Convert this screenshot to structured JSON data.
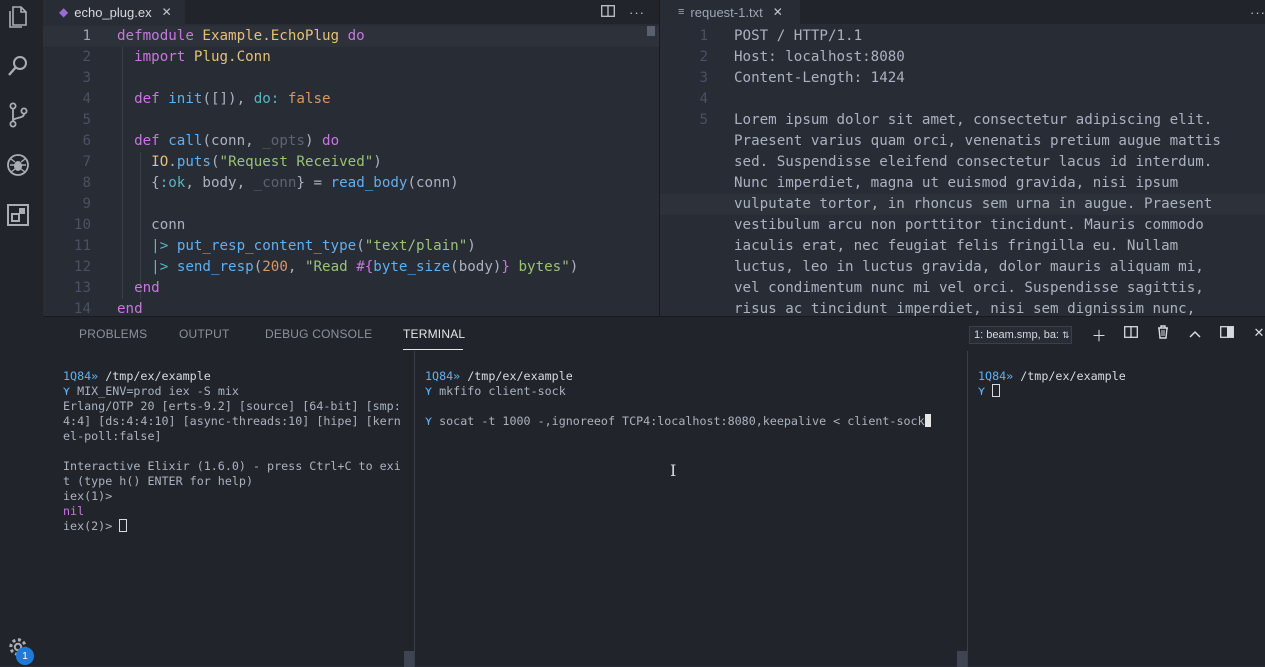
{
  "activity": {
    "icons": [
      "files-icon",
      "search-icon",
      "source-control-icon",
      "debug-icon",
      "extensions-icon",
      "gear-icon"
    ],
    "badge": "1"
  },
  "left_editor": {
    "tab_label": "echo_plug.ex",
    "lines": [
      "1",
      "2",
      "3",
      "4",
      "5",
      "6",
      "7",
      "8",
      "9",
      "10",
      "11",
      "12",
      "13",
      "14"
    ]
  },
  "right_editor": {
    "tab_label": "request-1.txt",
    "line_numbers": [
      "1",
      "2",
      "3",
      "4",
      "5"
    ],
    "lines": [
      "POST / HTTP/1.1",
      "Host: localhost:8080",
      "Content-Length: 1424",
      "",
      "Lorem ipsum dolor sit amet, consectetur adipiscing elit.",
      "Praesent varius quam orci, venenatis pretium augue mattis",
      "sed. Suspendisse eleifend consectetur lacus id interdum.",
      "Nunc imperdiet, magna ut euismod gravida, nisi ipsum",
      "vulputate tortor, in rhoncus sem urna in augue. Praesent",
      "vestibulum arcu non porttitor tincidunt. Mauris commodo",
      "iaculis erat, nec feugiat felis fringilla eu. Nullam",
      "luctus, leo in luctus gravida, dolor mauris aliquam mi,",
      "vel condimentum nunc mi vel orci. Suspendisse sagittis,",
      "risus ac tincidunt imperdiet, nisi sem dignissim nunc,"
    ]
  },
  "panel": {
    "tabs": [
      "PROBLEMS",
      "OUTPUT",
      "DEBUG CONSOLE",
      "TERMINAL"
    ],
    "terminal_select": "1: beam.smp, ba:",
    "terminals": {
      "t1": {
        "host": "1Q84»",
        "path": "/tmp/ex/example",
        "cmd": "MIX_ENV=prod iex -S mix",
        "out1": "Erlang/OTP 20 [erts-9.2] [source] [64-bit] [smp:",
        "out2": "4:4] [ds:4:4:10] [async-threads:10] [hipe] [kern",
        "out3": "el-poll:false]",
        "out4": "Interactive Elixir (1.6.0) - press Ctrl+C to exi",
        "out5": "t (type h() ENTER for help)",
        "prompt1": "iex(1)>",
        "nil": "nil",
        "prompt2": "iex(2)>"
      },
      "t2": {
        "host": "1Q84»",
        "path": "/tmp/ex/example",
        "cmd1": "mkfifo client-sock",
        "cmd2": "socat -t 1000 -,ignoreeof TCP4:localhost:8080,keepalive < client-sock"
      },
      "t3": {
        "host": "1Q84»",
        "path": "/tmp/ex/example"
      }
    }
  }
}
